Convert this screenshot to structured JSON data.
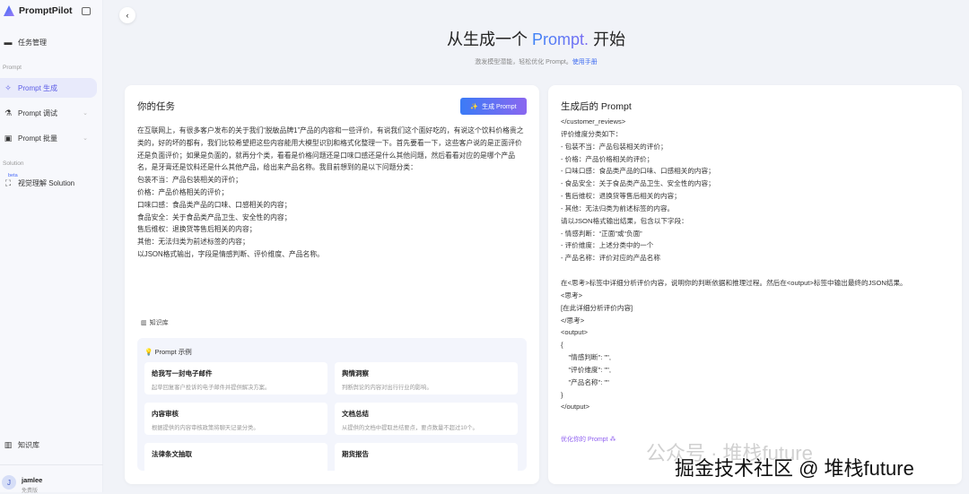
{
  "sidebar": {
    "app_name": "PromptPilot",
    "task_mgmt": "任务管理",
    "section_prompt": "Prompt",
    "items": [
      {
        "label": "Prompt 生成"
      },
      {
        "label": "Prompt 调试"
      },
      {
        "label": "Prompt 批量"
      }
    ],
    "section_solution": "Solution",
    "beta": "beta",
    "solution_item": "视觉理解 Solution",
    "knowledge": "知识库",
    "user": {
      "initial": "J",
      "name": "jamlee",
      "plan": "免费版"
    }
  },
  "hero": {
    "title_pre": "从生成一个 ",
    "title_hl": "Prompt.",
    "title_post": " 开始",
    "subtitle": "激发模型潜能，轻松优化 Prompt。",
    "manual_link": "使用手册"
  },
  "task": {
    "title": "你的任务",
    "generate_button": "生成 Prompt",
    "text": "在互联网上，有很多客户发布的关于我们“脱敏品牌1”产品的内容和一些评价，有说我们这个面好吃的，有说这个饮料价格贵之类的，好的坏的都有，我们比较希望把这些内容能用大模型识别和格式化整理一下。首先要看一下，这些客户说的是正面评价还是负面评价；如果是负面的，就再分个类，看看是价格问题还是口味口感还是什么其他问题，然后看看对应的是哪个产品名，是牙膏还是饮料还是什么其他产品，给出来产品名称。我目前想到的是以下问题分类：\n包装不当：产品包装相关的评价；\n价格：产品价格相关的评价；\n口味口感：食品类产品的口味、口感相关的内容；\n食品安全：关于食品类产品卫生、安全性的内容；\n售后维权：退换货等售后相关的内容；\n其他：无法归类为前述标签的内容；\n以JSON格式输出，字段是情感判断、评价维度、产品名称。",
    "knowledge_button": "知识库"
  },
  "examples": {
    "title": "Prompt 示例",
    "items": [
      {
        "title": "给我写一封电子邮件",
        "desc": "起草回复客户投诉的电子邮件并提供解决方案。"
      },
      {
        "title": "舆情洞察",
        "desc": "判断舆论的内容对出行行业的影响。"
      },
      {
        "title": "内容审核",
        "desc": "根据提供的内容审核政策将聊天记录分类。"
      },
      {
        "title": "文档总结",
        "desc": "从提供的文档中提取总结要点，要点数量不超过10个。"
      },
      {
        "title": "法律条文抽取",
        "desc": ""
      },
      {
        "title": "期货报告",
        "desc": ""
      }
    ]
  },
  "output": {
    "title": "生成后的 Prompt",
    "lines": [
      "</customer_reviews>",
      "评价维度分类如下：",
      "- 包装不当：产品包装相关的评价；",
      "- 价格：产品价格相关的评价；",
      "- 口味口感：食品类产品的口味、口感相关的内容；",
      "- 食品安全：关于食品类产品卫生、安全性的内容；",
      "- 售后维权：退换货等售后相关的内容；",
      "- 其他：无法归类为前述标签的内容。",
      "请以JSON格式输出结果，包含以下字段：",
      "- 情感判断：“正面”或“负面”",
      "- 评价维度：上述分类中的一个",
      "- 产品名称：评价对应的产品名称",
      " ",
      "在<思考>标签中详细分析评价内容，说明你的判断依据和推理过程。然后在<output>标签中输出最终的JSON结果。",
      "<思考>",
      "[在此详细分析评价内容]",
      "</思考>",
      "<output>",
      "{",
      "    \"情感判断\": \"\",",
      "    \"评价维度\": \"\",",
      "    \"产品名称\": \"\"",
      "}",
      "</output>"
    ],
    "optimize_link": "优化你的 Prompt"
  },
  "watermark": {
    "faint": "公众号 · 堆栈future",
    "main": "掘金技术社区 @ 堆栈future"
  }
}
